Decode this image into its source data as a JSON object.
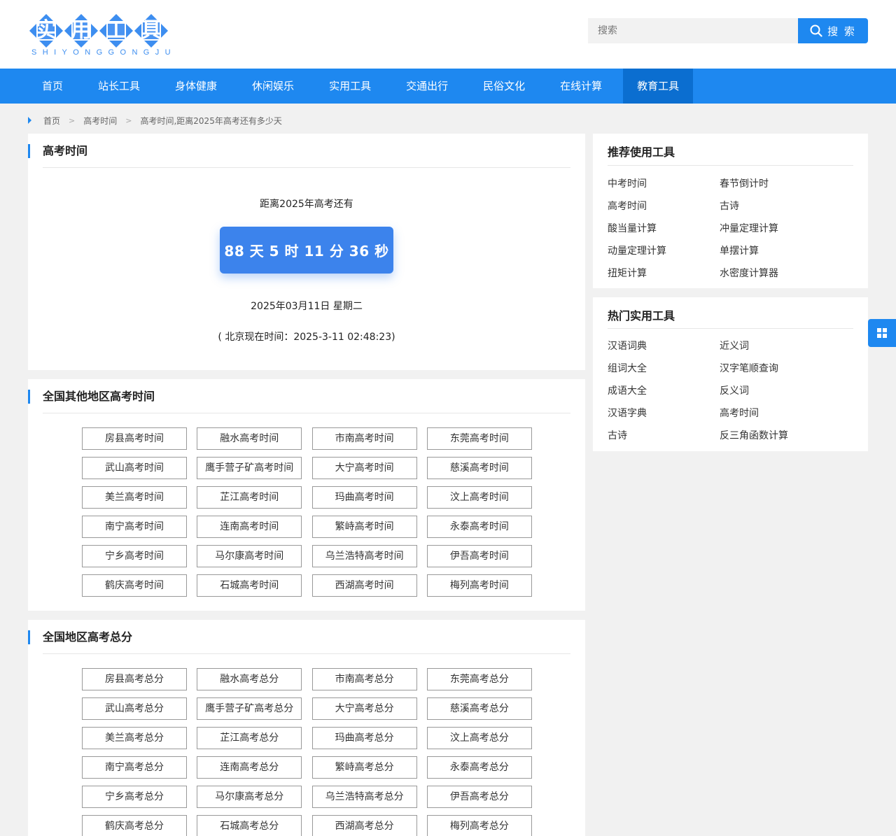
{
  "logo": {
    "chars": [
      "实",
      "用",
      "工",
      "具"
    ],
    "pinyin": "SHIYONGGONGJU"
  },
  "search": {
    "placeholder": "搜索",
    "button_label": "搜 索"
  },
  "nav": {
    "items": [
      "首页",
      "站长工具",
      "身体健康",
      "休闲娱乐",
      "实用工具",
      "交通出行",
      "民俗文化",
      "在线计算",
      "教育工具"
    ],
    "active": "教育工具"
  },
  "breadcrumb": {
    "home": "首页",
    "section": "高考时间",
    "current": "高考时间,距离2025年高考还有多少天",
    "separator": ">"
  },
  "countdown": {
    "title": "高考时间",
    "until_text": "距离2025年高考还有",
    "remaining": "88 天 5 时 11 分 36 秒",
    "today": "2025年03月11日 星期二",
    "beijing_time": "( 北京现在时间：2025-3-11 02:48:23)"
  },
  "regions_time": {
    "title": "全国其他地区高考时间",
    "items": [
      "房县高考时间",
      "融水高考时间",
      "市南高考时间",
      "东莞高考时间",
      "武山高考时间",
      "鹰手营子矿高考时间",
      "大宁高考时间",
      "慈溪高考时间",
      "美兰高考时间",
      "芷江高考时间",
      "玛曲高考时间",
      "汶上高考时间",
      "南宁高考时间",
      "连南高考时间",
      "繁峙高考时间",
      "永泰高考时间",
      "宁乡高考时间",
      "马尔康高考时间",
      "乌兰浩特高考时间",
      "伊吾高考时间",
      "鹤庆高考时间",
      "石城高考时间",
      "西湖高考时间",
      "梅列高考时间"
    ]
  },
  "regions_score": {
    "title": "全国地区高考总分",
    "items": [
      "房县高考总分",
      "融水高考总分",
      "市南高考总分",
      "东莞高考总分",
      "武山高考总分",
      "鹰手营子矿高考总分",
      "大宁高考总分",
      "慈溪高考总分",
      "美兰高考总分",
      "芷江高考总分",
      "玛曲高考总分",
      "汶上高考总分",
      "南宁高考总分",
      "连南高考总分",
      "繁峙高考总分",
      "永泰高考总分",
      "宁乡高考总分",
      "马尔康高考总分",
      "乌兰浩特高考总分",
      "伊吾高考总分",
      "鹤庆高考总分",
      "石城高考总分",
      "西湖高考总分",
      "梅列高考总分"
    ]
  },
  "recommended": {
    "title": "推荐使用工具",
    "items": [
      "中考时间",
      "春节倒计时",
      "高考时间",
      "古诗",
      "酸当量计算",
      "冲量定理计算",
      "动量定理计算",
      "单摆计算",
      "扭矩计算",
      "水密度计算器"
    ]
  },
  "popular": {
    "title": "热门实用工具",
    "items": [
      "汉语词典",
      "近义词",
      "组词大全",
      "汉字笔顺查询",
      "成语大全",
      "反义词",
      "汉语字典",
      "高考时间",
      "古诗",
      "反三角函数计算"
    ]
  },
  "colors": {
    "accent": "#1e88f0",
    "nav_active": "#0b6ed0",
    "countdown_bg": "#3c83ec"
  },
  "icons": {
    "search_button": "search-icon",
    "floating": "grid-icon",
    "breadcrumb": "caret-right-icon"
  }
}
